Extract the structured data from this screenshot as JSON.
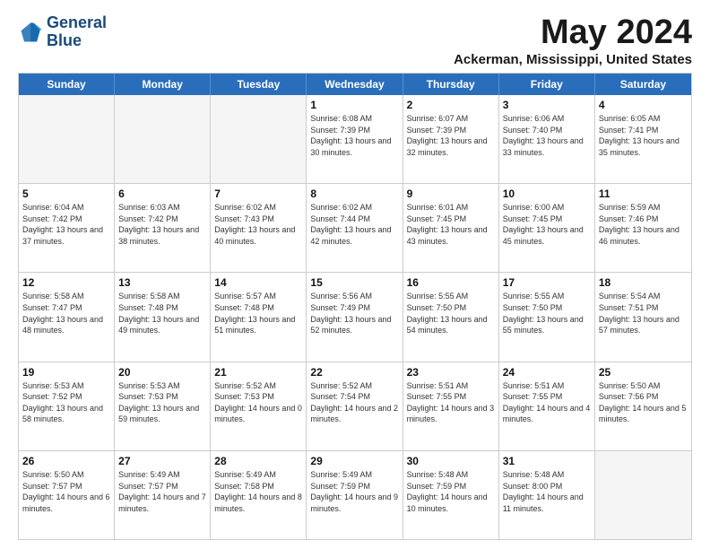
{
  "logo": {
    "line1": "General",
    "line2": "Blue"
  },
  "title": "May 2024",
  "location": "Ackerman, Mississippi, United States",
  "days_of_week": [
    "Sunday",
    "Monday",
    "Tuesday",
    "Wednesday",
    "Thursday",
    "Friday",
    "Saturday"
  ],
  "weeks": [
    [
      {
        "day": "",
        "sunrise": "",
        "sunset": "",
        "daylight": "",
        "empty": true
      },
      {
        "day": "",
        "sunrise": "",
        "sunset": "",
        "daylight": "",
        "empty": true
      },
      {
        "day": "",
        "sunrise": "",
        "sunset": "",
        "daylight": "",
        "empty": true
      },
      {
        "day": "1",
        "sunrise": "Sunrise: 6:08 AM",
        "sunset": "Sunset: 7:39 PM",
        "daylight": "Daylight: 13 hours and 30 minutes."
      },
      {
        "day": "2",
        "sunrise": "Sunrise: 6:07 AM",
        "sunset": "Sunset: 7:39 PM",
        "daylight": "Daylight: 13 hours and 32 minutes."
      },
      {
        "day": "3",
        "sunrise": "Sunrise: 6:06 AM",
        "sunset": "Sunset: 7:40 PM",
        "daylight": "Daylight: 13 hours and 33 minutes."
      },
      {
        "day": "4",
        "sunrise": "Sunrise: 6:05 AM",
        "sunset": "Sunset: 7:41 PM",
        "daylight": "Daylight: 13 hours and 35 minutes."
      }
    ],
    [
      {
        "day": "5",
        "sunrise": "Sunrise: 6:04 AM",
        "sunset": "Sunset: 7:42 PM",
        "daylight": "Daylight: 13 hours and 37 minutes."
      },
      {
        "day": "6",
        "sunrise": "Sunrise: 6:03 AM",
        "sunset": "Sunset: 7:42 PM",
        "daylight": "Daylight: 13 hours and 38 minutes."
      },
      {
        "day": "7",
        "sunrise": "Sunrise: 6:02 AM",
        "sunset": "Sunset: 7:43 PM",
        "daylight": "Daylight: 13 hours and 40 minutes."
      },
      {
        "day": "8",
        "sunrise": "Sunrise: 6:02 AM",
        "sunset": "Sunset: 7:44 PM",
        "daylight": "Daylight: 13 hours and 42 minutes."
      },
      {
        "day": "9",
        "sunrise": "Sunrise: 6:01 AM",
        "sunset": "Sunset: 7:45 PM",
        "daylight": "Daylight: 13 hours and 43 minutes."
      },
      {
        "day": "10",
        "sunrise": "Sunrise: 6:00 AM",
        "sunset": "Sunset: 7:45 PM",
        "daylight": "Daylight: 13 hours and 45 minutes."
      },
      {
        "day": "11",
        "sunrise": "Sunrise: 5:59 AM",
        "sunset": "Sunset: 7:46 PM",
        "daylight": "Daylight: 13 hours and 46 minutes."
      }
    ],
    [
      {
        "day": "12",
        "sunrise": "Sunrise: 5:58 AM",
        "sunset": "Sunset: 7:47 PM",
        "daylight": "Daylight: 13 hours and 48 minutes."
      },
      {
        "day": "13",
        "sunrise": "Sunrise: 5:58 AM",
        "sunset": "Sunset: 7:48 PM",
        "daylight": "Daylight: 13 hours and 49 minutes."
      },
      {
        "day": "14",
        "sunrise": "Sunrise: 5:57 AM",
        "sunset": "Sunset: 7:48 PM",
        "daylight": "Daylight: 13 hours and 51 minutes."
      },
      {
        "day": "15",
        "sunrise": "Sunrise: 5:56 AM",
        "sunset": "Sunset: 7:49 PM",
        "daylight": "Daylight: 13 hours and 52 minutes."
      },
      {
        "day": "16",
        "sunrise": "Sunrise: 5:55 AM",
        "sunset": "Sunset: 7:50 PM",
        "daylight": "Daylight: 13 hours and 54 minutes."
      },
      {
        "day": "17",
        "sunrise": "Sunrise: 5:55 AM",
        "sunset": "Sunset: 7:50 PM",
        "daylight": "Daylight: 13 hours and 55 minutes."
      },
      {
        "day": "18",
        "sunrise": "Sunrise: 5:54 AM",
        "sunset": "Sunset: 7:51 PM",
        "daylight": "Daylight: 13 hours and 57 minutes."
      }
    ],
    [
      {
        "day": "19",
        "sunrise": "Sunrise: 5:53 AM",
        "sunset": "Sunset: 7:52 PM",
        "daylight": "Daylight: 13 hours and 58 minutes."
      },
      {
        "day": "20",
        "sunrise": "Sunrise: 5:53 AM",
        "sunset": "Sunset: 7:53 PM",
        "daylight": "Daylight: 13 hours and 59 minutes."
      },
      {
        "day": "21",
        "sunrise": "Sunrise: 5:52 AM",
        "sunset": "Sunset: 7:53 PM",
        "daylight": "Daylight: 14 hours and 0 minutes."
      },
      {
        "day": "22",
        "sunrise": "Sunrise: 5:52 AM",
        "sunset": "Sunset: 7:54 PM",
        "daylight": "Daylight: 14 hours and 2 minutes."
      },
      {
        "day": "23",
        "sunrise": "Sunrise: 5:51 AM",
        "sunset": "Sunset: 7:55 PM",
        "daylight": "Daylight: 14 hours and 3 minutes."
      },
      {
        "day": "24",
        "sunrise": "Sunrise: 5:51 AM",
        "sunset": "Sunset: 7:55 PM",
        "daylight": "Daylight: 14 hours and 4 minutes."
      },
      {
        "day": "25",
        "sunrise": "Sunrise: 5:50 AM",
        "sunset": "Sunset: 7:56 PM",
        "daylight": "Daylight: 14 hours and 5 minutes."
      }
    ],
    [
      {
        "day": "26",
        "sunrise": "Sunrise: 5:50 AM",
        "sunset": "Sunset: 7:57 PM",
        "daylight": "Daylight: 14 hours and 6 minutes."
      },
      {
        "day": "27",
        "sunrise": "Sunrise: 5:49 AM",
        "sunset": "Sunset: 7:57 PM",
        "daylight": "Daylight: 14 hours and 7 minutes."
      },
      {
        "day": "28",
        "sunrise": "Sunrise: 5:49 AM",
        "sunset": "Sunset: 7:58 PM",
        "daylight": "Daylight: 14 hours and 8 minutes."
      },
      {
        "day": "29",
        "sunrise": "Sunrise: 5:49 AM",
        "sunset": "Sunset: 7:59 PM",
        "daylight": "Daylight: 14 hours and 9 minutes."
      },
      {
        "day": "30",
        "sunrise": "Sunrise: 5:48 AM",
        "sunset": "Sunset: 7:59 PM",
        "daylight": "Daylight: 14 hours and 10 minutes."
      },
      {
        "day": "31",
        "sunrise": "Sunrise: 5:48 AM",
        "sunset": "Sunset: 8:00 PM",
        "daylight": "Daylight: 14 hours and 11 minutes."
      },
      {
        "day": "",
        "sunrise": "",
        "sunset": "",
        "daylight": "",
        "empty": true
      }
    ]
  ]
}
